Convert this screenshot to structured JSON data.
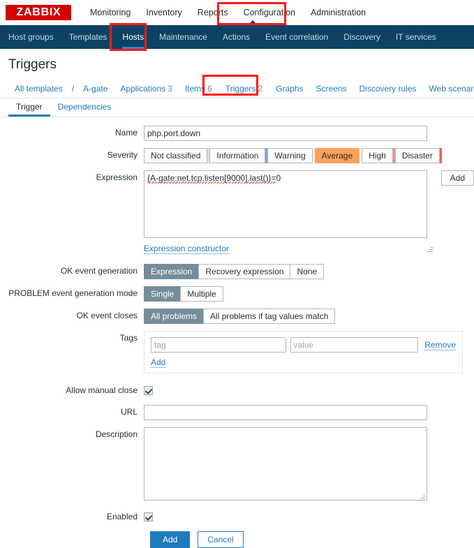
{
  "brand": {
    "logo_text": "ZABBIX"
  },
  "topmenu": {
    "items": [
      {
        "label": "Monitoring",
        "active": false
      },
      {
        "label": "Inventory",
        "active": false
      },
      {
        "label": "Reports",
        "active": false
      },
      {
        "label": "Configuration",
        "active": true
      },
      {
        "label": "Administration",
        "active": false
      }
    ]
  },
  "subnav": {
    "items": [
      {
        "label": "Host groups",
        "active": false
      },
      {
        "label": "Templates",
        "active": false
      },
      {
        "label": "Hosts",
        "active": true
      },
      {
        "label": "Maintenance",
        "active": false
      },
      {
        "label": "Actions",
        "active": false
      },
      {
        "label": "Event correlation",
        "active": false
      },
      {
        "label": "Discovery",
        "active": false
      },
      {
        "label": "IT services",
        "active": false
      }
    ]
  },
  "page": {
    "title": "Triggers"
  },
  "breadcrumb": {
    "all_templates": "All templates",
    "separator": "/",
    "host": "A-gate",
    "items": [
      {
        "label": "Applications",
        "count": "3",
        "selected": false
      },
      {
        "label": "Items",
        "count": "6",
        "selected": false
      },
      {
        "label": "Triggers",
        "count": "2",
        "selected": true
      },
      {
        "label": "Graphs",
        "count": "",
        "selected": false
      },
      {
        "label": "Screens",
        "count": "",
        "selected": false
      },
      {
        "label": "Discovery rules",
        "count": "",
        "selected": false
      },
      {
        "label": "Web scenarios",
        "count": "",
        "selected": false
      }
    ]
  },
  "tabs": [
    {
      "label": "Trigger",
      "active": true
    },
    {
      "label": "Dependencies",
      "active": false
    }
  ],
  "form": {
    "name": {
      "label": "Name",
      "value": "php.port.down",
      "placeholder": ""
    },
    "severity": {
      "label": "Severity",
      "options": [
        {
          "label": "Not classified",
          "selected": false,
          "separator_color": "#d8dde0"
        },
        {
          "label": "Information",
          "selected": false,
          "separator_color": "#7ba9d4"
        },
        {
          "label": "Warning",
          "selected": false,
          "separator_color": "#ffc859"
        },
        {
          "label": "Average",
          "selected": true,
          "separator_color": "#ffa059"
        },
        {
          "label": "High",
          "selected": false,
          "separator_color": "#ff8b7a"
        },
        {
          "label": "Disaster",
          "selected": false,
          "separator_color": "#ff5b52"
        }
      ],
      "selected_color": "#ffa059"
    },
    "expression": {
      "label": "Expression",
      "value": "{A-gate:net.tcp.listen[9000].last()}=0",
      "add_button": "Add",
      "constructor_link": "Expression constructor"
    },
    "ok_event_generation": {
      "label": "OK event generation",
      "options": [
        {
          "label": "Expression",
          "selected": true
        },
        {
          "label": "Recovery expression",
          "selected": false
        },
        {
          "label": "None",
          "selected": false
        }
      ]
    },
    "problem_event_generation_mode": {
      "label": "PROBLEM event generation mode",
      "options": [
        {
          "label": "Single",
          "selected": true
        },
        {
          "label": "Multiple",
          "selected": false
        }
      ]
    },
    "ok_event_closes": {
      "label": "OK event closes",
      "options": [
        {
          "label": "All problems",
          "selected": true
        },
        {
          "label": "All problems if tag values match",
          "selected": false
        }
      ]
    },
    "tags": {
      "label": "Tags",
      "rows": [
        {
          "tag_placeholder": "tag",
          "tag_value": "",
          "value_placeholder": "value",
          "value_value": "",
          "remove_label": "Remove"
        }
      ],
      "add_label": "Add"
    },
    "allow_manual_close": {
      "label": "Allow manual close",
      "checked": true
    },
    "url": {
      "label": "URL",
      "value": "",
      "placeholder": ""
    },
    "description": {
      "label": "Description",
      "value": "",
      "placeholder": ""
    },
    "enabled": {
      "label": "Enabled",
      "checked": true
    },
    "actions": {
      "submit_label": "Add",
      "cancel_label": "Cancel",
      "submit_color": "#1f7bbd"
    }
  },
  "annotations": {
    "highlight_color": "#ff1a1a",
    "boxes": [
      {
        "target": "Configuration"
      },
      {
        "target": "Hosts"
      },
      {
        "target": "Triggers 2"
      }
    ]
  }
}
